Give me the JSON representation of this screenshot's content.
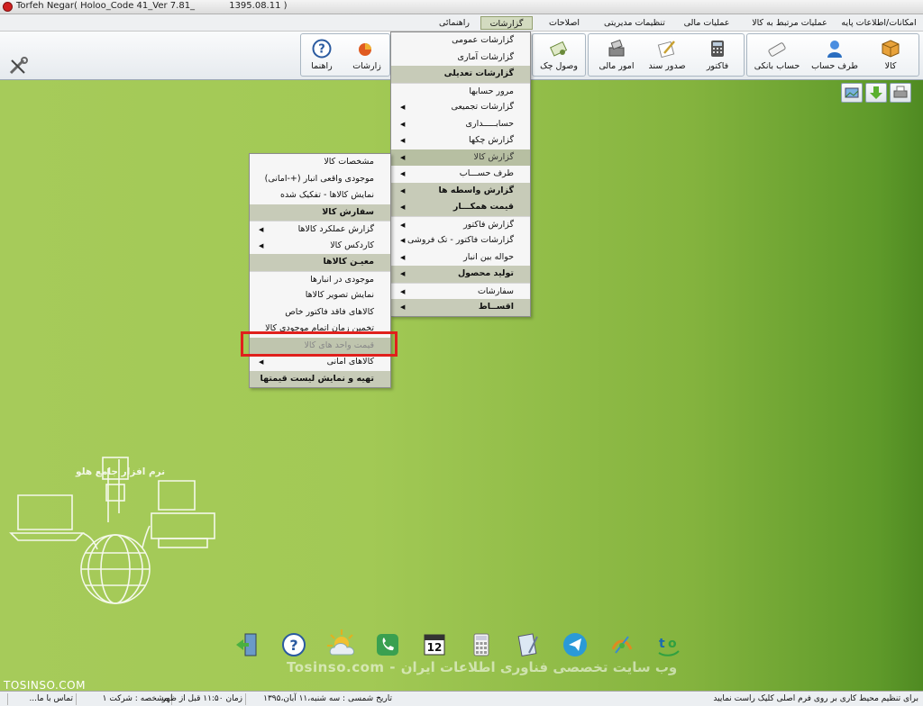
{
  "window": {
    "title": "Torfeh Negar( Holoo_Code 41_Ver 7.81_            1395.08.11 )"
  },
  "menubar": {
    "items": [
      {
        "label": "امکانات/اطلاعات پایه"
      },
      {
        "label": "عملیات مرتبط به کالا"
      },
      {
        "label": "عملیات مالی"
      },
      {
        "label": "تنظیمات مدیریتی"
      },
      {
        "label": "اصلاحات"
      },
      {
        "label": "گزارشات"
      },
      {
        "label": "راهنمائی"
      }
    ]
  },
  "toolbar": {
    "buttons": [
      {
        "label": "کالا",
        "icon": "box-icon"
      },
      {
        "label": "طرف حساب",
        "icon": "person-icon"
      },
      {
        "label": "حساب بانکی",
        "icon": "bank-card-icon"
      },
      {
        "label": "فاکتور",
        "icon": "calculator-icon"
      },
      {
        "label": "صدور سند",
        "icon": "pen-document-icon"
      },
      {
        "label": "امور مالی",
        "icon": "cash-register-icon"
      },
      {
        "label": "وصول چک",
        "icon": "check-receive-icon"
      },
      {
        "label": "زارشات",
        "icon": "report-icon"
      },
      {
        "label": "راهنما",
        "icon": "help-icon"
      }
    ]
  },
  "reports_menu": {
    "rows": [
      {
        "label": "گزارشات عمومی",
        "type": "item",
        "arrow": false
      },
      {
        "label": "گزارشات آماری",
        "type": "item",
        "arrow": false
      },
      {
        "label": "گزارشات تعدیلی",
        "type": "header",
        "arrow": false
      },
      {
        "label": "مرور حسابها",
        "type": "item",
        "arrow": false
      },
      {
        "label": "گزارشات تجمیعی",
        "type": "item",
        "arrow": true
      },
      {
        "label": "حسابـــــداری",
        "type": "item",
        "arrow": true
      },
      {
        "label": "گزارش چکها",
        "type": "item",
        "arrow": true
      },
      {
        "label": "گزارش کالا",
        "type": "hl",
        "arrow": true
      },
      {
        "label": "طرف حســـاب",
        "type": "item",
        "arrow": true
      },
      {
        "label": "گزارش واسطه ها",
        "type": "header",
        "arrow": true
      },
      {
        "label": "قیمت همکـــار",
        "type": "header",
        "arrow": true
      },
      {
        "label": "گزارش فاکتور",
        "type": "item",
        "arrow": true
      },
      {
        "label": "گزارشات فاکتور - تک فروشی",
        "type": "item",
        "arrow": true
      },
      {
        "label": "حواله بین انبار",
        "type": "item",
        "arrow": true
      },
      {
        "label": "تولید محصول",
        "type": "header",
        "arrow": true
      },
      {
        "label": "سفارشات",
        "type": "item",
        "arrow": true
      },
      {
        "label": "اقســاط",
        "type": "header",
        "arrow": true
      }
    ]
  },
  "goods_menu": {
    "rows": [
      {
        "label": "مشخصات کالا",
        "type": "item",
        "arrow": false
      },
      {
        "label": "موجودی واقعی انبار (+-امانی)",
        "type": "item",
        "arrow": false
      },
      {
        "label": "نمایش کالاها - تفکیک شده",
        "type": "item",
        "arrow": false
      },
      {
        "label": "سفارش کالا",
        "type": "header",
        "arrow": false
      },
      {
        "label": "گزارش عملکرد کالاها",
        "type": "item",
        "arrow": true
      },
      {
        "label": "کاردکس کالا",
        "type": "item",
        "arrow": true
      },
      {
        "label": "معیـن کالاها",
        "type": "header",
        "arrow": false
      },
      {
        "label": "موجودی در انبارها",
        "type": "item",
        "arrow": false
      },
      {
        "label": "نمایش تصویر کالاها",
        "type": "item",
        "arrow": false
      },
      {
        "label": "کالاهای فاقد فاکتور خاص",
        "type": "item",
        "arrow": false
      },
      {
        "label": "تخمین زمان اتمام موجودی کالا",
        "type": "item",
        "arrow": false
      },
      {
        "label": "قیمت واحد های کالا",
        "type": "dim",
        "arrow": false
      },
      {
        "label": "کالاهای امانی",
        "type": "item",
        "arrow": true
      },
      {
        "label": "تهیه و نمایش لیست قیمتها",
        "type": "header",
        "arrow": false
      }
    ]
  },
  "desktop": {
    "logo_text": "نرم افزار جامع هلو",
    "watermark": "Tosinso.com - وب سایت تخصصی فناوری اطلاعات ایران",
    "brand": "TOSINSO.COM",
    "dock_icons": [
      "exit-icon",
      "help-icon",
      "weather-icon",
      "phone-icon",
      "calendar-icon",
      "calculator-icon",
      "notepad-icon",
      "send-icon",
      "satellite-icon",
      "logo-icon"
    ],
    "calendar_day": "12"
  },
  "statusbar": {
    "hint": "برای تنظیم محیط کاری بر روی فرم اصلی کلیک راست نمایید",
    "date": "تاریخ شمسی : سه شنبه،۱۱ آبان،۱۳۹۵",
    "time": "زمان ۱۱:۵۰ قبل از ظهر",
    "company": "مشخصه : شرکت ۱",
    "contact": "تماس با ما..."
  },
  "colors": {
    "accent": "#e0201c",
    "desktop": "#a6cb5a",
    "menu_header": "#c7cbb8"
  }
}
